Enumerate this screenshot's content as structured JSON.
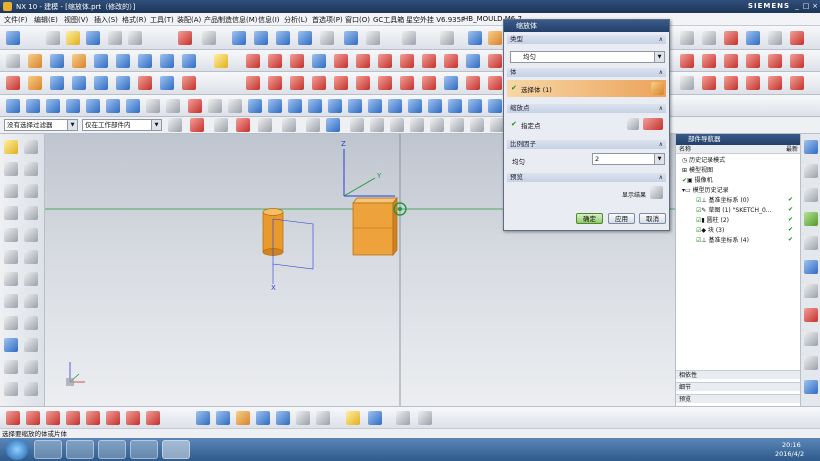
{
  "titlebar": {
    "title": "NX 10 - 建模 - [缩放体.prt（修改的）]",
    "brand": "SIEMENS",
    "min": "_",
    "max": "□",
    "close": "×"
  },
  "menu": [
    "文件(F)",
    "编辑(E)",
    "视图(V)",
    "插入(S)",
    "格式(R)",
    "工具(T)",
    "装配(A)",
    "产品制造信息(M)",
    "信息(I)",
    "分析(L)",
    "首选项(P)",
    "窗口(O)",
    "GC工具箱",
    "星空外挂 V6.935F",
    "HB_MOULD M6.7"
  ],
  "filter": {
    "selection_filter": "没有选择过滤器",
    "scope": "仅在工作部件内"
  },
  "dialog": {
    "title": "缩放体",
    "type_section": "类型",
    "type_value": "均匀",
    "body_section": "体",
    "select_body": "选择体 (1)",
    "point_section": "缩放点",
    "specify_point": "指定点",
    "factor_section": "比例因子",
    "uniform_label": "均匀",
    "uniform_value": "2",
    "preview_section": "预览",
    "show_result": "显示结果",
    "ok": "确定",
    "apply": "应用",
    "cancel": "取消"
  },
  "navigator": {
    "title": "部件导航器",
    "col_name": "名称",
    "col_latest": "最新",
    "items": [
      "历史记录模式",
      "模型视图",
      "摄像机",
      "模型历史记录",
      "基准坐标系 (0)",
      "草图 (1) \"SKETCH_0...",
      "圆柱 (2)",
      "块 (3)",
      "基准坐标系 (4)"
    ],
    "panels": [
      "相依性",
      "细节",
      "预览"
    ]
  },
  "status": {
    "prompt": "选择要缩放的体或片体"
  },
  "taskbar": {
    "time": "20:16",
    "date": "2016/4/2"
  },
  "viewport": {
    "axis_x": "X",
    "axis_y": "Y",
    "axis_z": "Z"
  },
  "colors": {
    "accent_orange": "#e89a2c",
    "title_blue": "#23406a",
    "axis_blue": "#2a3fd6",
    "axis_green": "#1e9a3c"
  }
}
